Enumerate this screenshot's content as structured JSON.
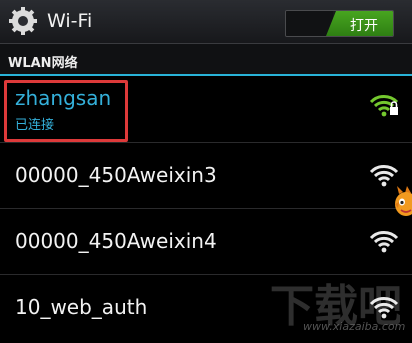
{
  "header": {
    "title": "Wi-Fi",
    "toggle_label": "打开",
    "toggle_state": "on",
    "accent_color": "#3a9a1b"
  },
  "section": {
    "label": "WLAN网络",
    "divider_color": "#29b3d8"
  },
  "networks": [
    {
      "name": "zhangsan",
      "status": "已连接",
      "icon": "wifi-locked-icon",
      "connected": true
    },
    {
      "name": "00000_450Aweixin3",
      "icon": "wifi-icon"
    },
    {
      "name": "00000_450Aweixin4",
      "icon": "wifi-icon"
    },
    {
      "name": "10_web_auth",
      "icon": "wifi-icon"
    }
  ],
  "watermark": {
    "text": "下载吧",
    "url": "www.xiazaiba.com"
  },
  "colors": {
    "connected_text": "#34b0da",
    "highlight_box": "#dd3a3a",
    "wifi_connected": "#74c82e"
  }
}
